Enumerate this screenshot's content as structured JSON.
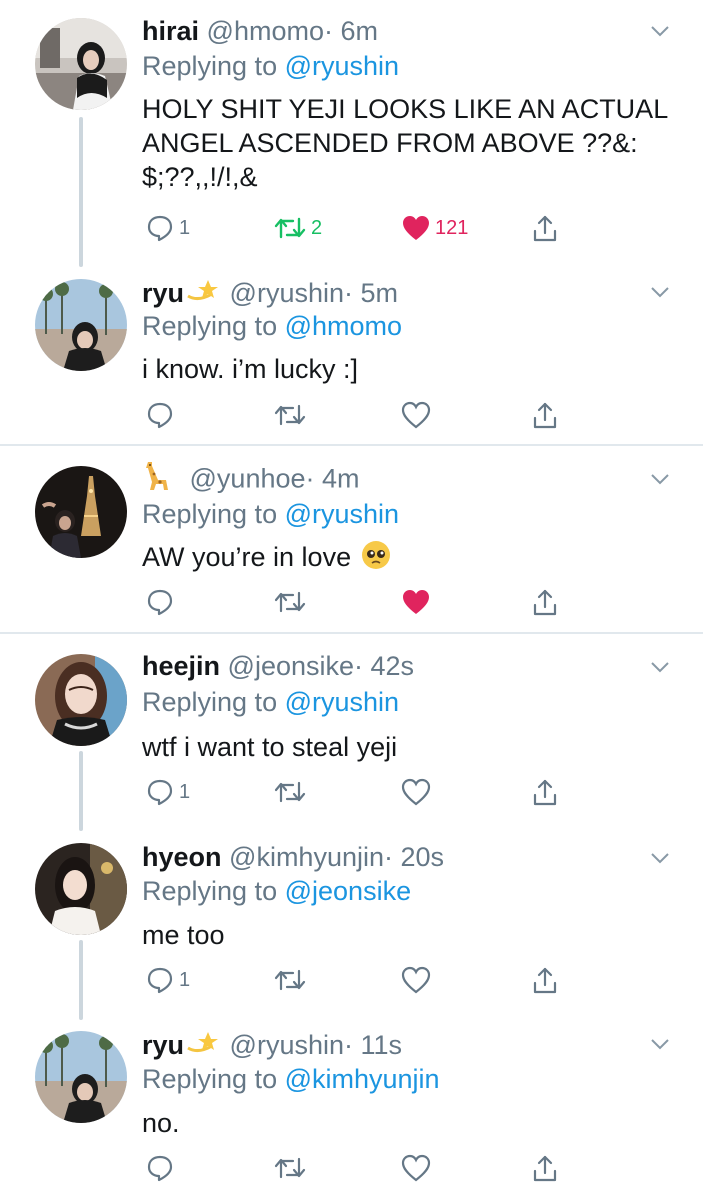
{
  "tweets": [
    {
      "name": "hirai",
      "handle": "@hmomo",
      "time": "· 6m",
      "replying_prefix": "Replying to",
      "replying_to": "@ryushin",
      "text": "HOLY SHIT YEJI LOOKS LIKE AN ACTUAL ANGEL ASCENDED FROM ABOVE ??&: $;??,,!/!,&",
      "replies": "1",
      "retweets": "2",
      "likes": "121",
      "retweeted": true,
      "liked": true
    },
    {
      "name": "ryu",
      "name_emoji": "dizzy-star-emoji",
      "handle": "@ryushin",
      "time": "· 5m",
      "replying_prefix": "Replying to",
      "replying_to": "@hmomo",
      "text": "i know. i’m lucky :]",
      "replies": "",
      "retweets": "",
      "likes": "",
      "retweeted": false,
      "liked": false
    },
    {
      "name": "",
      "name_emoji": "giraffe-emoji",
      "handle": "@yunhoe",
      "time": "· 4m",
      "replying_prefix": "Replying to",
      "replying_to": "@ryushin",
      "text": "AW you’re in love",
      "text_emoji": "pleading-face-emoji",
      "replies": "",
      "retweets": "",
      "likes": "",
      "retweeted": false,
      "liked": true
    },
    {
      "name": "heejin",
      "handle": "@jeonsike",
      "time": "· 42s",
      "replying_prefix": "Replying to",
      "replying_to": "@ryushin",
      "text": "wtf i want to steal yeji",
      "replies": "1",
      "retweets": "",
      "likes": "",
      "retweeted": false,
      "liked": false
    },
    {
      "name": "hyeon",
      "handle": "@kimhyunjin",
      "time": "· 20s",
      "replying_prefix": "Replying to",
      "replying_to": "@jeonsike",
      "text": "me too",
      "replies": "1",
      "retweets": "",
      "likes": "",
      "retweeted": false,
      "liked": false
    },
    {
      "name": "ryu",
      "name_emoji": "dizzy-star-emoji",
      "handle": "@ryushin",
      "time": "· 11s",
      "replying_prefix": "Replying to",
      "replying_to": "@kimhyunjin",
      "text": "no.",
      "replies": "",
      "retweets": "",
      "likes": "",
      "retweeted": false,
      "liked": false
    }
  ],
  "colors": {
    "text": "#14171a",
    "secondary": "#657786",
    "link": "#1b95e0",
    "retweet": "#17bf63",
    "like": "#e0245e",
    "divider": "#e1e8ed",
    "thread": "#ccd6dd"
  }
}
